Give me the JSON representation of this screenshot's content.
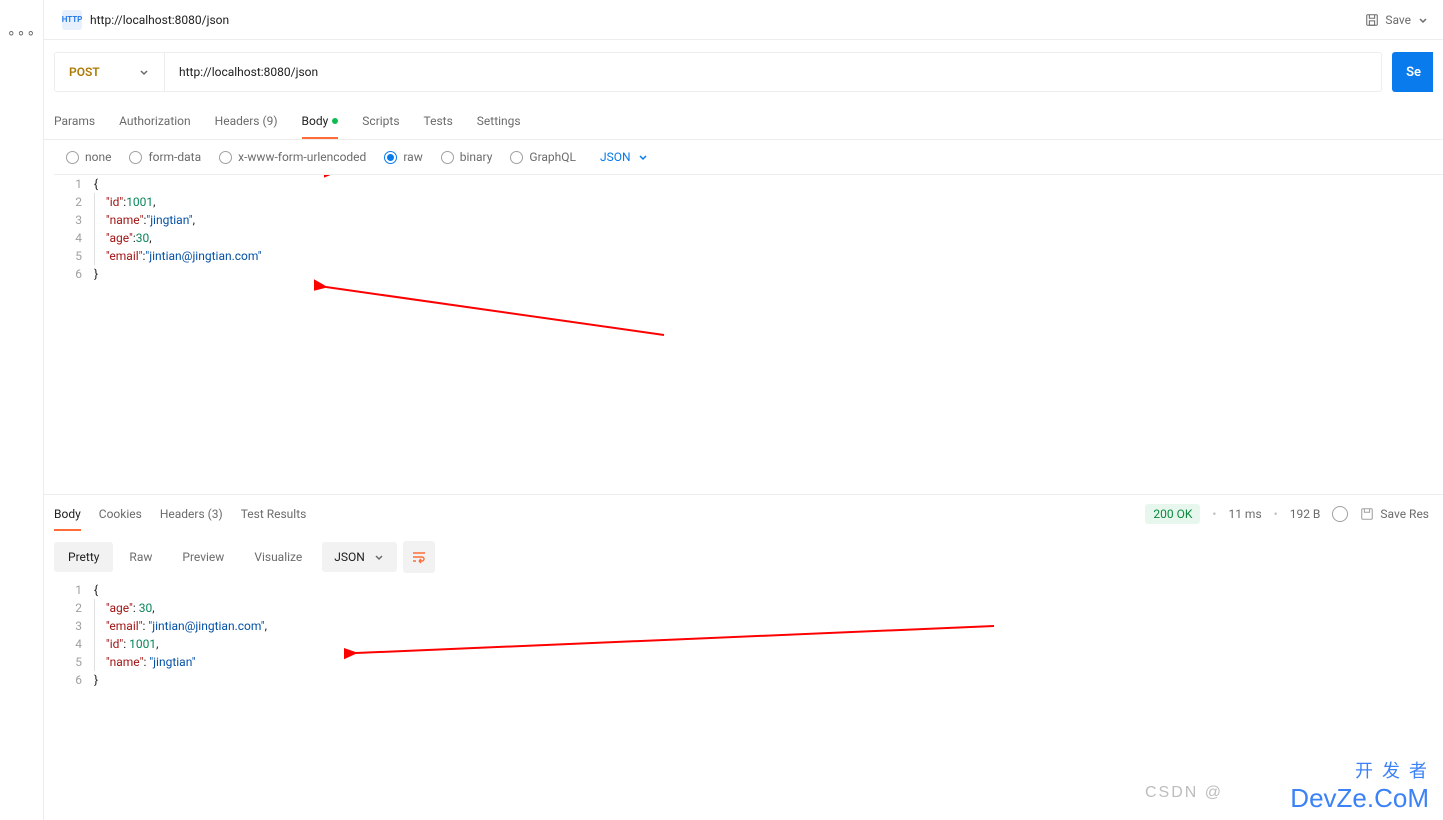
{
  "tab": {
    "title": "http://localhost:8080/json",
    "badge": "HTTP"
  },
  "save_label": "Save",
  "request": {
    "method": "POST",
    "url": "http://localhost:8080/json",
    "send_label": "Se"
  },
  "req_tabs": {
    "params": "Params",
    "auth": "Authorization",
    "headers": "Headers (9)",
    "body": "Body",
    "scripts": "Scripts",
    "tests": "Tests",
    "settings": "Settings"
  },
  "body_types": {
    "none": "none",
    "formdata": "form-data",
    "xwww": "x-www-form-urlencoded",
    "raw": "raw",
    "binary": "binary",
    "graphql": "GraphQL",
    "lang": "JSON"
  },
  "request_body": {
    "lines": [
      "1",
      "2",
      "3",
      "4",
      "5",
      "6"
    ],
    "id_key": "\"id\"",
    "id_val": "1001",
    "name_key": "\"name\"",
    "name_val": "\"jingtian\"",
    "age_key": "\"age\"",
    "age_val": "30",
    "email_key": "\"email\"",
    "email_val": "\"jintian@jingtian.com\""
  },
  "resp_tabs": {
    "body": "Body",
    "cookies": "Cookies",
    "headers": "Headers (3)",
    "test": "Test Results"
  },
  "status": {
    "code": "200 OK",
    "time": "11 ms",
    "size": "192 B",
    "save": "Save Res"
  },
  "resp_view": {
    "pretty": "Pretty",
    "raw": "Raw",
    "preview": "Preview",
    "visualize": "Visualize",
    "lang": "JSON"
  },
  "response_body": {
    "lines": [
      "1",
      "2",
      "3",
      "4",
      "5",
      "6"
    ],
    "age_key": "\"age\"",
    "age_val": "30",
    "email_key": "\"email\"",
    "email_val": "\"jintian@jingtian.com\"",
    "id_key": "\"id\"",
    "id_val": "1001",
    "name_key": "\"name\"",
    "name_val": "\"jingtian\""
  },
  "watermark": {
    "line1": "开 发 者",
    "line2": "DevZe.CoM",
    "csdn": "CSDN @"
  }
}
